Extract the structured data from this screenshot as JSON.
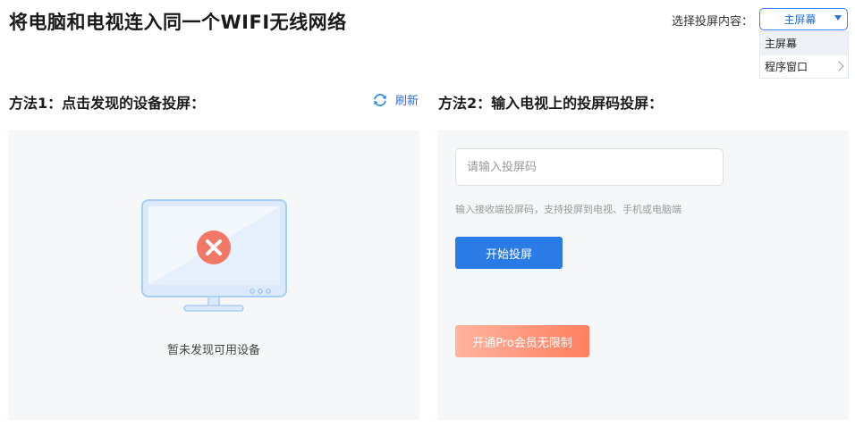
{
  "header": {
    "title": "将电脑和电视连入同一个WIFI无线网络",
    "select_label": "选择投屏内容：",
    "select_value": "主屏幕",
    "options": [
      "主屏幕",
      "程序窗口"
    ]
  },
  "method1": {
    "title": "方法1：点击发现的设备投屏：",
    "refresh_label": "刷新",
    "empty_text": "暂未发现可用设备"
  },
  "method2": {
    "title": "方法2：输入电视上的投屏码投屏：",
    "input_placeholder": "请输入投屏码",
    "hint": "输入接收端投屏码，支持投屏到电视、手机或电脑端",
    "start_button": "开始投屏",
    "pro_button": "开通Pro会员无限制"
  },
  "colors": {
    "accent": "#2a7be6",
    "error": "#f27866",
    "pro_gradient_start": "#ffb3a0",
    "pro_gradient_end": "#ff7f5e"
  }
}
